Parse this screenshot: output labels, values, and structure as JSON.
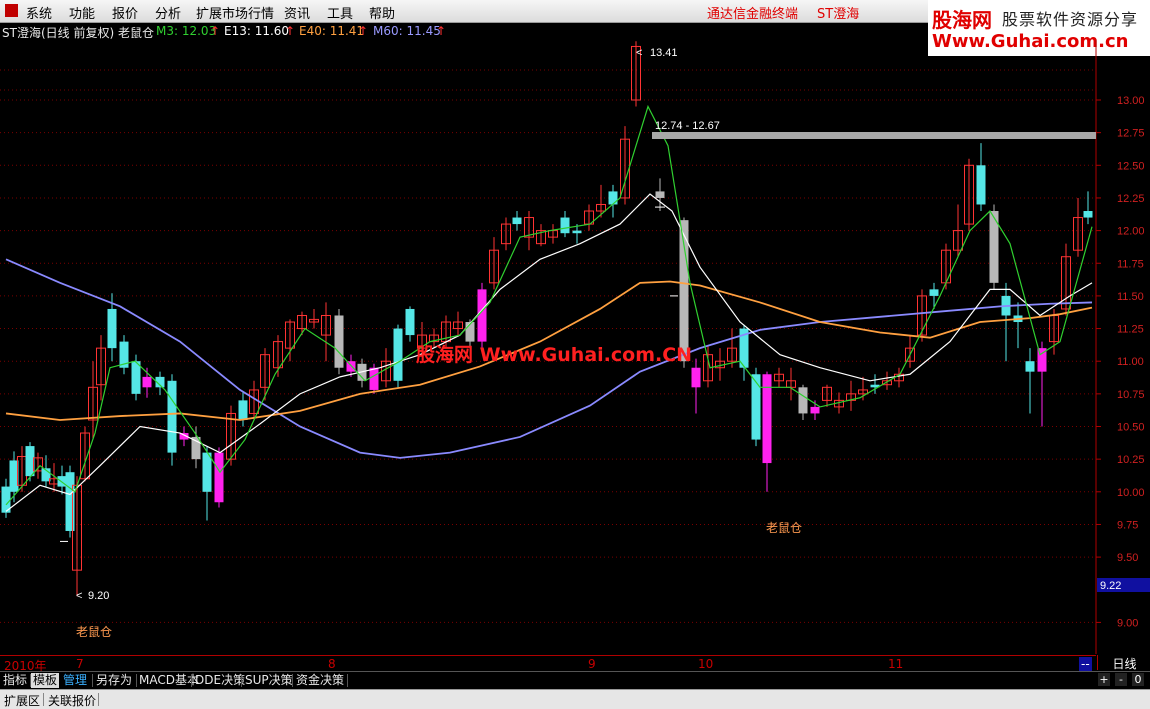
{
  "menu": {
    "items": [
      "系统",
      "功能",
      "报价",
      "分析",
      "扩展市场行情",
      "资讯",
      "工具",
      "帮助"
    ],
    "right_items": [
      "通达信金融终端",
      "ST澄海"
    ]
  },
  "brand": {
    "line1": "股海网",
    "line2": "股票软件资源分享",
    "line3": "Www.Guhai.com.cn"
  },
  "infobar": {
    "title": "ST澄海(日线 前复权) 老鼠仓",
    "m3": "M3: 12.03",
    "e13": "E13: 11.60",
    "e40": "E40: 11.41",
    "m60": "M60: 11.45",
    "arrow": "↑"
  },
  "chart": {
    "watermark": "股海网 Www.Guhai.com.CN",
    "label1": "老鼠仓",
    "label2": "老鼠仓",
    "high_label": "13.41",
    "low_label": "9.20",
    "band_label": "12.74 - 12.67",
    "price_tag": "9.22",
    "y_ticks": [
      "13.00",
      "12.75",
      "12.50",
      "12.25",
      "12.00",
      "11.75",
      "11.50",
      "11.25",
      "11.00",
      "10.75",
      "10.50",
      "10.25",
      "10.00",
      "9.75",
      "9.50",
      "9.00"
    ],
    "colors": {
      "up": "#ff3333",
      "down": "#55e6e6",
      "pink": "#ff22ee",
      "gray": "#b8b8b8",
      "m60": "#8a8aff",
      "e40": "#ffa040",
      "e13": "#ffffff",
      "m3": "#30d030"
    }
  },
  "timebar": {
    "labels": [
      "2010年",
      "7",
      "8",
      "9",
      "10",
      "11"
    ],
    "period": "日线"
  },
  "tabs": [
    "指标",
    "模板",
    "管理",
    "另存为",
    "MACD基本",
    "DDE决策",
    "SUP决策",
    "资金决策"
  ],
  "zoom": [
    "+",
    "-",
    "0"
  ],
  "status": [
    "扩展区",
    "关联报价"
  ]
}
